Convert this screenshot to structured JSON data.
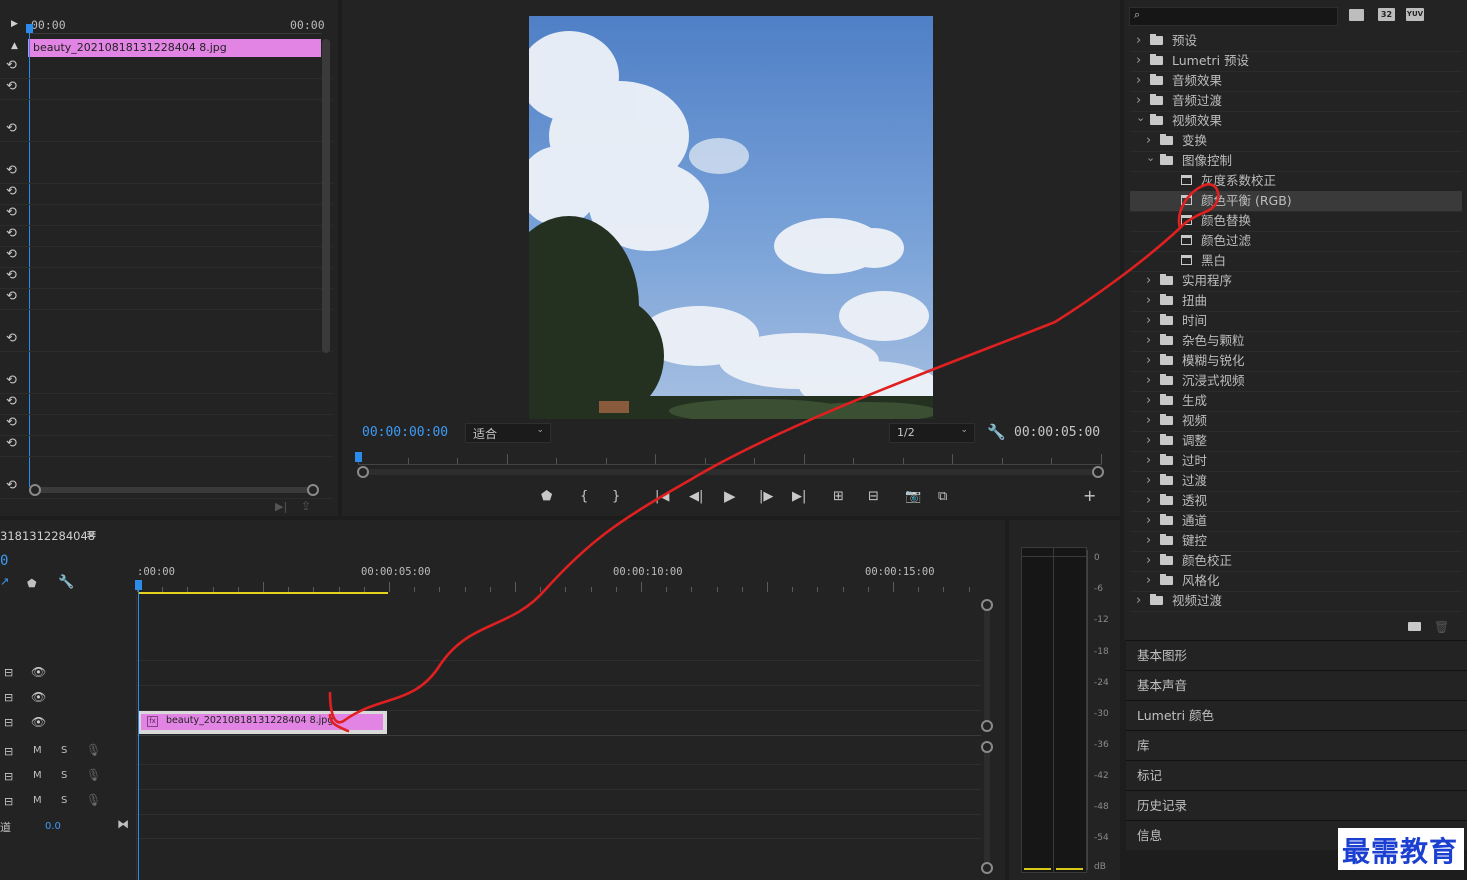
{
  "effect_controls": {
    "timecode_start": "00:00",
    "timecode_end": "00:00",
    "clip_name": "beauty_20210818131228404 8.jpg"
  },
  "program_monitor": {
    "timecode": "00:00:00:00",
    "fit_label": "适合",
    "resolution": "1/2",
    "duration": "00:00:05:00"
  },
  "timeline": {
    "sequence_name": "3181312284048",
    "playhead_timecode": "0",
    "ruler": [
      ":00:00",
      "00:00:05:00",
      "00:00:10:00",
      "00:00:15:00"
    ],
    "clip_name": "beauty_20210818131228404 8.jpg",
    "track_M": "M",
    "track_S": "S",
    "master_label": "道",
    "master_value": "0.0"
  },
  "audio_meter": {
    "ticks": [
      "0",
      "-6",
      "-12",
      "-18",
      "-24",
      "-30",
      "-36",
      "-42",
      "-48",
      "-54",
      "dB"
    ]
  },
  "effects_panel": {
    "search_placeholder": "",
    "badges": [
      "32",
      "YUV"
    ],
    "tree": [
      {
        "label": "预设",
        "level": 0,
        "kind": "folder",
        "open": false
      },
      {
        "label": "Lumetri 预设",
        "level": 0,
        "kind": "folder",
        "open": false
      },
      {
        "label": "音频效果",
        "level": 0,
        "kind": "folder",
        "open": false
      },
      {
        "label": "音频过渡",
        "level": 0,
        "kind": "folder",
        "open": false
      },
      {
        "label": "视频效果",
        "level": 0,
        "kind": "folder",
        "open": true
      },
      {
        "label": "变换",
        "level": 1,
        "kind": "folder",
        "open": false
      },
      {
        "label": "图像控制",
        "level": 1,
        "kind": "folder",
        "open": true
      },
      {
        "label": "灰度系数校正",
        "level": 2,
        "kind": "effect"
      },
      {
        "label": "颜色平衡 (RGB)",
        "level": 2,
        "kind": "effect",
        "selected": true
      },
      {
        "label": "颜色替换",
        "level": 2,
        "kind": "effect"
      },
      {
        "label": "颜色过滤",
        "level": 2,
        "kind": "effect"
      },
      {
        "label": "黑白",
        "level": 2,
        "kind": "effect"
      },
      {
        "label": "实用程序",
        "level": 1,
        "kind": "folder",
        "open": false
      },
      {
        "label": "扭曲",
        "level": 1,
        "kind": "folder",
        "open": false
      },
      {
        "label": "时间",
        "level": 1,
        "kind": "folder",
        "open": false
      },
      {
        "label": "杂色与颗粒",
        "level": 1,
        "kind": "folder",
        "open": false
      },
      {
        "label": "模糊与锐化",
        "level": 1,
        "kind": "folder",
        "open": false
      },
      {
        "label": "沉浸式视频",
        "level": 1,
        "kind": "folder",
        "open": false
      },
      {
        "label": "生成",
        "level": 1,
        "kind": "folder",
        "open": false
      },
      {
        "label": "视频",
        "level": 1,
        "kind": "folder",
        "open": false
      },
      {
        "label": "调整",
        "level": 1,
        "kind": "folder",
        "open": false
      },
      {
        "label": "过时",
        "level": 1,
        "kind": "folder",
        "open": false
      },
      {
        "label": "过渡",
        "level": 1,
        "kind": "folder",
        "open": false
      },
      {
        "label": "透视",
        "level": 1,
        "kind": "folder",
        "open": false
      },
      {
        "label": "通道",
        "level": 1,
        "kind": "folder",
        "open": false
      },
      {
        "label": "键控",
        "level": 1,
        "kind": "folder",
        "open": false
      },
      {
        "label": "颜色校正",
        "level": 1,
        "kind": "folder",
        "open": false
      },
      {
        "label": "风格化",
        "level": 1,
        "kind": "folder",
        "open": false
      },
      {
        "label": "视频过渡",
        "level": 0,
        "kind": "folder",
        "open": false
      }
    ],
    "panels": [
      "基本图形",
      "基本声音",
      "Lumetri 颜色",
      "库",
      "标记",
      "历史记录",
      "信息"
    ]
  },
  "watermark": "最需教育",
  "colors": {
    "clip": "#e184e3",
    "accent": "#2d8ceb",
    "annotation": "#e02020",
    "work_area": "#e6d21a"
  }
}
